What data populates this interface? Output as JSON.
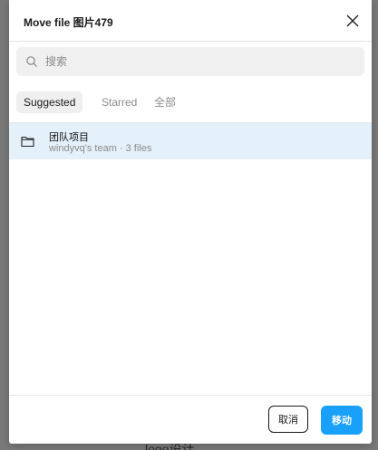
{
  "background": {
    "partial_text": "logo设计"
  },
  "dialog": {
    "title": "Move file 图片479",
    "close_icon": "close-icon",
    "search": {
      "placeholder": "搜索",
      "value": "",
      "icon": "search-icon"
    },
    "tabs": [
      {
        "label": "Suggested",
        "active": true
      },
      {
        "label": "Starred",
        "active": false
      },
      {
        "label": "全部",
        "active": false
      }
    ],
    "items": [
      {
        "name": "团队项目",
        "meta": "windyvq's team · 3 files",
        "icon": "folder-icon",
        "selected": true
      }
    ],
    "buttons": {
      "cancel": "取消",
      "confirm": "移动"
    }
  },
  "colors": {
    "accent": "#18a0fb",
    "selected_row": "#e4f1fb",
    "backdrop": "#7a7a7a"
  }
}
